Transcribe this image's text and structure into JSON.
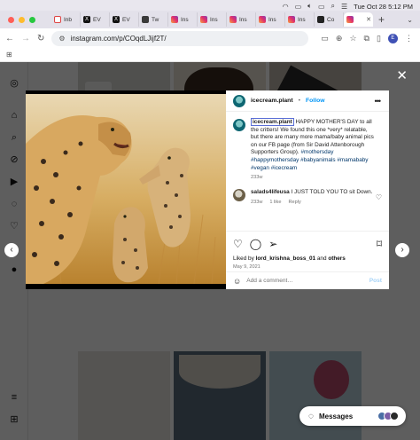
{
  "menubar": {
    "datetime": "Tue Oct 28  5:12 PM"
  },
  "tabs": [
    {
      "label": "Inb",
      "favicon": "gmail-icon"
    },
    {
      "label": "EV",
      "favicon": "x-icon"
    },
    {
      "label": "EV",
      "favicon": "x-icon"
    },
    {
      "label": "Tw",
      "favicon": "twitch-icon"
    },
    {
      "label": "Ins",
      "favicon": "instagram-icon"
    },
    {
      "label": "Ins",
      "favicon": "instagram-icon"
    },
    {
      "label": "Ins",
      "favicon": "instagram-icon"
    },
    {
      "label": "Ins",
      "favicon": "instagram-icon"
    },
    {
      "label": "Ins",
      "favicon": "instagram-icon"
    },
    {
      "label": "Co",
      "favicon": "c-icon"
    },
    {
      "label": "",
      "favicon": "instagram-icon",
      "active": true
    }
  ],
  "toolbar": {
    "url": "instagram.com/p/COqdLJijf2T/",
    "profile_initial": "E"
  },
  "post": {
    "username": "icecream.plant",
    "separator": "•",
    "follow_label": "Follow",
    "caption_user": "icecream.plant",
    "caption_text": " HAPPY MOTHER'S DAY to all the critters! We found this one *very* relatable, but there are many more mama/baby animal pics on our FB page (from Sir David Attenborough Supporters Group). ",
    "caption_tags": "#mothersday #happymothersday #babyanimals #mamababy #vegan #icecream",
    "caption_age": "233w",
    "comment_user": "salads4lifeusa",
    "comment_text": " I JUST TOLD YOU TO sit Down.",
    "comment_age": "233w",
    "comment_likes": "1 like",
    "comment_reply": "Reply",
    "likes_prefix": "Liked by ",
    "likes_user": "lord_krishna_boss_01",
    "likes_suffix": " and ",
    "likes_others": "others",
    "date": "May 9, 2021",
    "add_comment_placeholder": "Add a comment…",
    "post_label": "Post"
  },
  "messages": {
    "label": "Messages"
  }
}
